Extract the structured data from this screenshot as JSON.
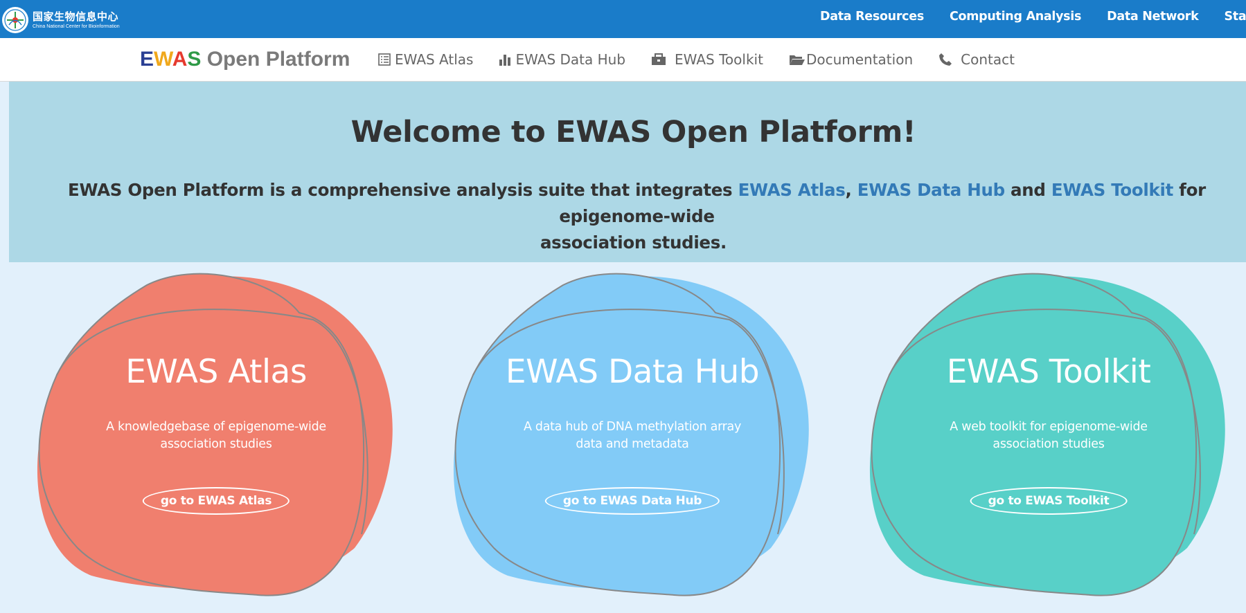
{
  "topbar": {
    "org_cn": "国家生物信息中心",
    "org_en": "China National Center for Bioinformation",
    "links": [
      "Data Resources",
      "Computing Analysis",
      "Data Network",
      "Standards"
    ]
  },
  "brand": {
    "e": "E",
    "w": "W",
    "a": "A",
    "s": "S",
    "rest": " Open Platform"
  },
  "nav": [
    {
      "label": "EWAS Atlas",
      "icon": "list-icon"
    },
    {
      "label": "EWAS Data Hub",
      "icon": "bar-chart-icon"
    },
    {
      "label": "EWAS Toolkit",
      "icon": "briefcase-icon"
    },
    {
      "label": "Documentation",
      "icon": "folder-open-icon"
    },
    {
      "label": "Contact",
      "icon": "phone-icon"
    }
  ],
  "hero": {
    "title": "Welcome to EWAS Open Platform!",
    "intro_start": "EWAS Open Platform is a comprehensive analysis suite that integrates ",
    "link1": "EWAS Atlas",
    "sep1": ", ",
    "link2": "EWAS Data Hub",
    "sep2": " and ",
    "link3": "EWAS Toolkit",
    "intro_end1": " for epigenome-wide",
    "intro_end2": "association studies."
  },
  "cards": [
    {
      "title": "EWAS Atlas",
      "desc": "A knowledgebase of epigenome-wide association studies",
      "button": "go to EWAS Atlas",
      "color": "#f07f6e"
    },
    {
      "title": "EWAS Data Hub",
      "desc": "A data hub of DNA methylation array data and metadata",
      "button": "go to EWAS Data Hub",
      "color": "#82cbf7"
    },
    {
      "title": "EWAS Toolkit",
      "desc": "A web toolkit for epigenome-wide association studies",
      "button": "go to EWAS Toolkit",
      "color": "#58d0c8"
    }
  ]
}
